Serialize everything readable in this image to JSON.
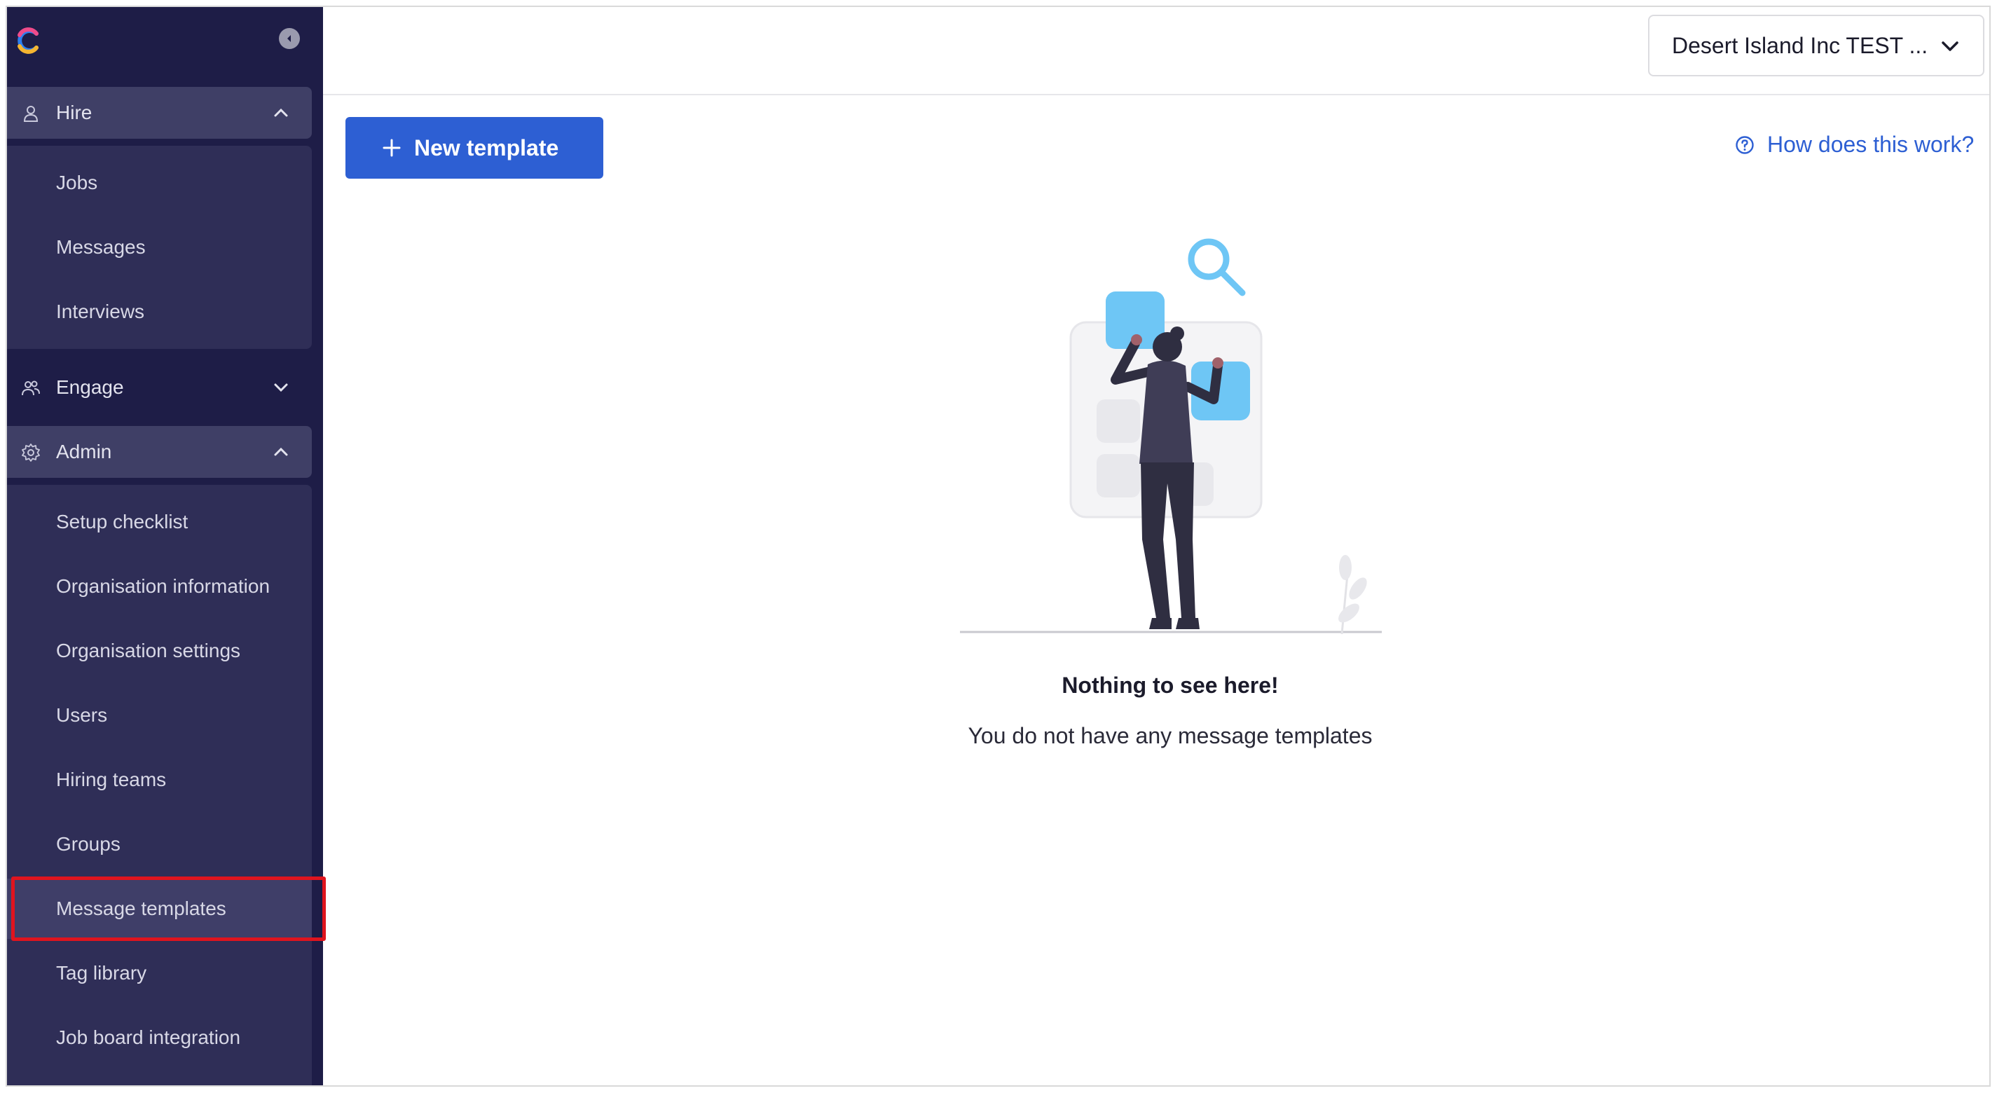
{
  "sidebar": {
    "sections": [
      {
        "label": "Hire",
        "icon": "person-icon",
        "expanded": true,
        "items": [
          {
            "label": "Jobs"
          },
          {
            "label": "Messages"
          },
          {
            "label": "Interviews"
          }
        ]
      },
      {
        "label": "Engage",
        "icon": "people-icon",
        "expanded": false,
        "items": []
      },
      {
        "label": "Admin",
        "icon": "gear-icon",
        "expanded": true,
        "items": [
          {
            "label": "Setup checklist"
          },
          {
            "label": "Organisation information"
          },
          {
            "label": "Organisation settings"
          },
          {
            "label": "Users"
          },
          {
            "label": "Hiring teams"
          },
          {
            "label": "Groups"
          },
          {
            "label": "Message templates",
            "active": true
          },
          {
            "label": "Tag library"
          },
          {
            "label": "Job board integration"
          }
        ]
      }
    ]
  },
  "topbar": {
    "org_selector": "Desert Island Inc TEST ..."
  },
  "toolbar": {
    "new_button": "New template",
    "help_link": "How does this work?"
  },
  "empty_state": {
    "title": "Nothing to see here!",
    "subtitle": "You do not have any message templates"
  },
  "colors": {
    "sidebar_bg": "#1e1d47",
    "submenu_bg": "#2f2e57",
    "accent": "#2d5fd3",
    "highlight": "#e0141e",
    "illustration_blue": "#6ec6f5"
  }
}
